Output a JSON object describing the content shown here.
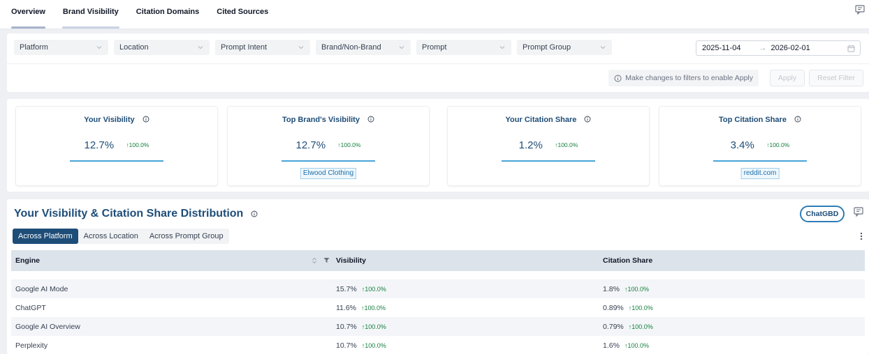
{
  "tabs": [
    {
      "label": "Overview"
    },
    {
      "label": "Brand Visibility"
    },
    {
      "label": "Citation Domains"
    },
    {
      "label": "Cited Sources"
    }
  ],
  "filters": {
    "selects": [
      {
        "label": "Platform"
      },
      {
        "label": "Location"
      },
      {
        "label": "Prompt Intent"
      },
      {
        "label": "Brand/Non-Brand"
      },
      {
        "label": "Prompt"
      },
      {
        "label": "Prompt Group"
      }
    ],
    "date_start": "2025-11-04",
    "date_arrow": "→",
    "date_end": "2026-02-01",
    "hint": "Make changes to filters to enable Apply",
    "apply_label": "Apply",
    "reset_label": "Reset Filter"
  },
  "kpis": [
    {
      "title": "Your Visibility",
      "value": "12.7%",
      "delta": "↑100.0%",
      "tag": ""
    },
    {
      "title": "Top Brand's Visibility",
      "value": "12.7%",
      "delta": "↑100.0%",
      "tag": "Elwood Clothing"
    },
    {
      "title": "Your Citation Share",
      "value": "1.2%",
      "delta": "↑100.0%",
      "tag": ""
    },
    {
      "title": "Top Citation Share",
      "value": "3.4%",
      "delta": "↑100.0%",
      "tag": "reddit.com"
    }
  ],
  "distribution": {
    "title": "Your Visibility & Citation Share Distribution",
    "ai_button": "ChatGBD",
    "segments": [
      {
        "label": "Across Platform"
      },
      {
        "label": "Across Location"
      },
      {
        "label": "Across Prompt Group"
      }
    ],
    "columns": [
      "Engine",
      "Visibility",
      "Citation Share"
    ],
    "rows": [
      {
        "engine": "Google AI Mode",
        "visibility": "15.7%",
        "vis_delta": "↑100.0%",
        "citation": "1.8%",
        "cit_delta": "↑100.0%"
      },
      {
        "engine": "ChatGPT",
        "visibility": "11.6%",
        "vis_delta": "↑100.0%",
        "citation": "0.89%",
        "cit_delta": "↑100.0%"
      },
      {
        "engine": "Google AI Overview",
        "visibility": "10.7%",
        "vis_delta": "↑100.0%",
        "citation": "0.79%",
        "cit_delta": "↑100.0%"
      },
      {
        "engine": "Perplexity",
        "visibility": "10.7%",
        "vis_delta": "↑100.0%",
        "citation": "1.6%",
        "cit_delta": "↑100.0%"
      }
    ]
  },
  "colors": {
    "brand": "#1e4d78",
    "accent": "#4aa3d8",
    "positive": "#15803d"
  }
}
